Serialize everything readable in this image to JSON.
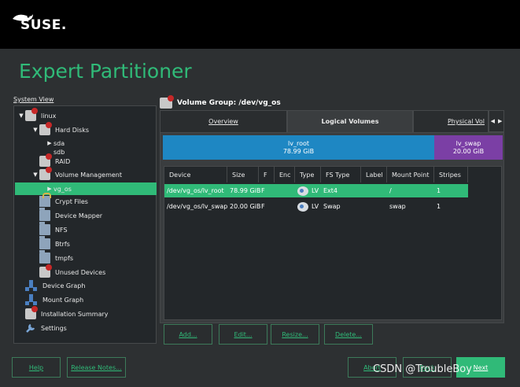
{
  "brand": {
    "logo_text": "SUSE."
  },
  "title": "Expert Partitioner",
  "system_view": {
    "label": "System View",
    "tree": [
      {
        "label": "linux",
        "indent": 0,
        "arrow": "▼",
        "icon": "disk"
      },
      {
        "label": "Hard Disks",
        "indent": 1,
        "arrow": "▼",
        "icon": "disk"
      },
      {
        "label": "sda",
        "indent": 2,
        "arrow": "▶",
        "icon": ""
      },
      {
        "label": "sdb",
        "indent": 2,
        "arrow": "",
        "icon": ""
      },
      {
        "label": "RAID",
        "indent": 1,
        "arrow": "",
        "icon": "disk"
      },
      {
        "label": "Volume Management",
        "indent": 1,
        "arrow": "▼",
        "icon": "disk"
      },
      {
        "label": "vg_os",
        "indent": 2,
        "arrow": "▶",
        "icon": "",
        "selected": true
      },
      {
        "label": "Crypt Files",
        "indent": 1,
        "arrow": "",
        "icon": "lock"
      },
      {
        "label": "Device Mapper",
        "indent": 1,
        "arrow": "",
        "icon": "folder"
      },
      {
        "label": "NFS",
        "indent": 1,
        "arrow": "",
        "icon": "folder"
      },
      {
        "label": "Btrfs",
        "indent": 1,
        "arrow": "",
        "icon": "folder"
      },
      {
        "label": "tmpfs",
        "indent": 1,
        "arrow": "",
        "icon": "folder"
      },
      {
        "label": "Unused Devices",
        "indent": 1,
        "arrow": "",
        "icon": "disk"
      },
      {
        "label": "Device Graph",
        "indent": 0,
        "arrow": "",
        "icon": "graph"
      },
      {
        "label": "Mount Graph",
        "indent": 0,
        "arrow": "",
        "icon": "graph"
      },
      {
        "label": "Installation Summary",
        "indent": 0,
        "arrow": "",
        "icon": "disk"
      },
      {
        "label": "Settings",
        "indent": 0,
        "arrow": "",
        "icon": "wrench"
      }
    ]
  },
  "volume_group": {
    "header": "Volume Group: /dev/vg_os"
  },
  "tabs": [
    {
      "label": "Overview",
      "active": false
    },
    {
      "label": "Logical Volumes",
      "active": true
    },
    {
      "label": "Physical Vol",
      "active": false
    }
  ],
  "usage_bar": [
    {
      "name": "lv_root",
      "size": "78.99 GiB",
      "fraction": 0.798,
      "color": "#1e87c3"
    },
    {
      "name": "lv_swap",
      "size": "20.00 GiB",
      "fraction": 0.202,
      "color": "#7b3fa5"
    }
  ],
  "table": {
    "headers": [
      "Device",
      "Size",
      "F",
      "Enc",
      "Type",
      "FS Type",
      "Label",
      "Mount Point",
      "Stripes"
    ],
    "rows": [
      {
        "device": "/dev/vg_os/lv_root",
        "size": "78.99 GiB",
        "f": "F",
        "enc": "",
        "type": "LV",
        "fs_type": "Ext4",
        "label": "",
        "mount": "/",
        "stripes": "1",
        "selected": true
      },
      {
        "device": "/dev/vg_os/lv_swap",
        "size": "20.00 GiB",
        "f": "F",
        "enc": "",
        "type": "LV",
        "fs_type": "Swap",
        "label": "",
        "mount": "swap",
        "stripes": "1",
        "selected": false
      }
    ]
  },
  "actions": {
    "add": "Add...",
    "edit": "Edit...",
    "resize": "Resize...",
    "delete": "Delete..."
  },
  "footer": {
    "help": "Help",
    "release_notes": "Release Notes...",
    "abort": "Abort",
    "back": "Back",
    "next": "Next"
  },
  "watermark": "CSDN @TroubleBoy",
  "colors": {
    "accent": "#30ba78",
    "lv_root": "#1e87c3",
    "lv_swap": "#7b3fa5"
  }
}
